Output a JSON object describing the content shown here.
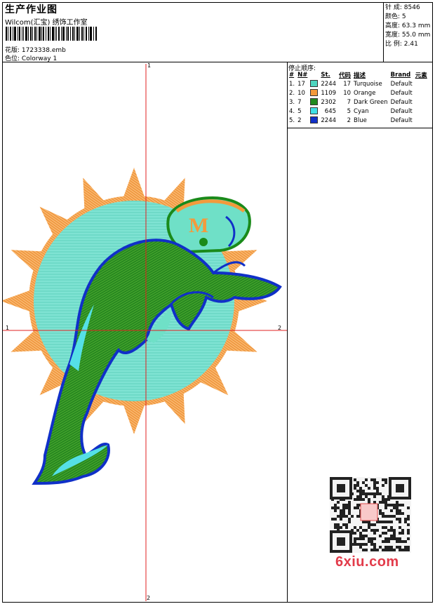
{
  "header": {
    "title": "生产作业图",
    "company": "Wilcom(汇宝) 绣饰工作室",
    "design_file_label": "花版:",
    "design_file": "1723338.emb",
    "colorway_label": "色位:",
    "colorway": "Colorway 1"
  },
  "stats": [
    {
      "label": "针 成:",
      "value": "8546"
    },
    {
      "label": "颜色:",
      "value": "5"
    },
    {
      "label": "高度:",
      "value": "63.3 mm"
    },
    {
      "label": "宽度:",
      "value": "55.0 mm"
    },
    {
      "label": "比 例:",
      "value": "2.41"
    }
  ],
  "stop_sequence": {
    "title": "停止顺序:",
    "headers": [
      "#",
      "N#",
      "St.",
      "代码",
      "描述",
      "Brand",
      "元素"
    ],
    "rows": [
      {
        "num": "1.",
        "n": "17",
        "color": "#4fd6c0",
        "st": "2244",
        "code": "17",
        "desc": "Turquoise",
        "brand": "Default"
      },
      {
        "num": "2.",
        "n": "10",
        "color": "#f39a3c",
        "st": "1109",
        "code": "10",
        "desc": "Orange",
        "brand": "Default"
      },
      {
        "num": "3.",
        "n": "7",
        "color": "#1f8a1f",
        "st": "2302",
        "code": "7",
        "desc": "Dark Green",
        "brand": "Default"
      },
      {
        "num": "4.",
        "n": "5",
        "color": "#3ee0e6",
        "st": "645",
        "code": "5",
        "desc": "Cyan",
        "brand": "Default"
      },
      {
        "num": "5.",
        "n": "2",
        "color": "#1030c8",
        "st": "2244",
        "code": "2",
        "desc": "Blue",
        "brand": "Default"
      }
    ]
  },
  "axes": {
    "top": "1",
    "bottom": "2",
    "left": "1",
    "right": "2"
  },
  "logo_letter": "M",
  "watermark": "6xiu.com"
}
